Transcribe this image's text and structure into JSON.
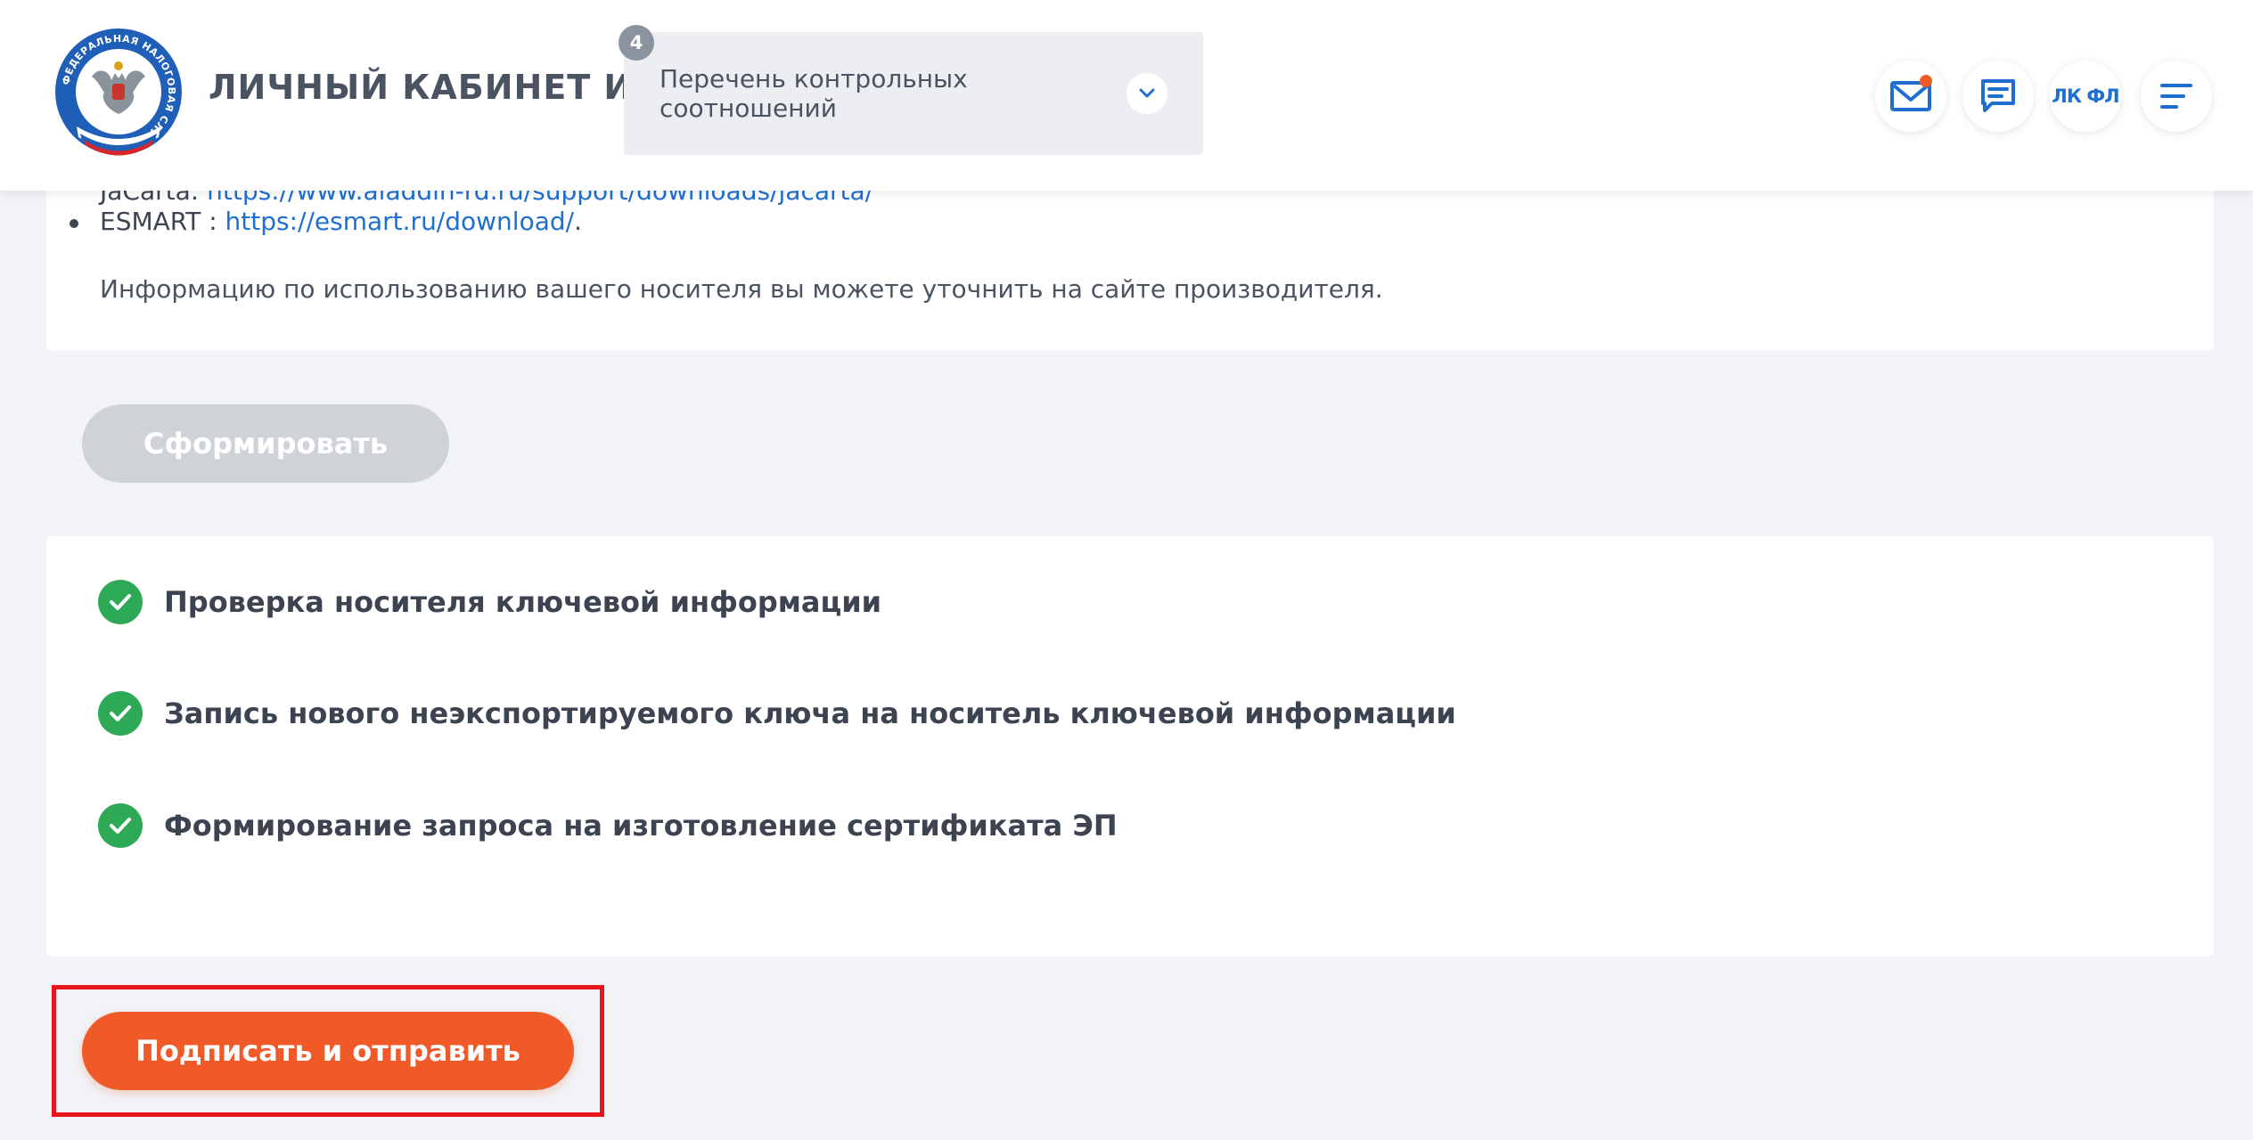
{
  "header": {
    "logo_ring_text": "ФЕДЕРАЛЬНАЯ НАЛОГОВАЯ СЛУЖБА",
    "title": "ЛИЧНЫЙ КАБИНЕТ ИП",
    "select": {
      "badge": "4",
      "value": "Перечень контрольных соотношений"
    },
    "buttons": {
      "lkfl_label": "ЛК ФЛ"
    }
  },
  "info_card": {
    "clipped_prefix": "JaCarta: ",
    "clipped_link": "https://www.aladdin-rd.ru/support/downloads/jacarta/",
    "bullet_prefix": "ESMART : ",
    "bullet_link": "https://esmart.ru/download/",
    "bullet_suffix": ".",
    "info_text": "Информацию по использованию вашего носителя вы можете уточнить на сайте производителя."
  },
  "actions": {
    "generate_label": "Сформировать",
    "sign_label": "Подписать и отправить"
  },
  "steps": [
    {
      "label": "Проверка носителя ключевой информации",
      "status": "done"
    },
    {
      "label": "Запись нового неэкспортируемого ключа на носитель ключевой информации",
      "status": "done"
    },
    {
      "label": "Формирование запроса на изготовление сертификата ЭП",
      "status": "done"
    }
  ],
  "colors": {
    "accent": "#f05a28",
    "success": "#2eaa57",
    "link": "#1f6fd1",
    "highlight": "#e8141c",
    "disabled": "#cfd3d8"
  }
}
